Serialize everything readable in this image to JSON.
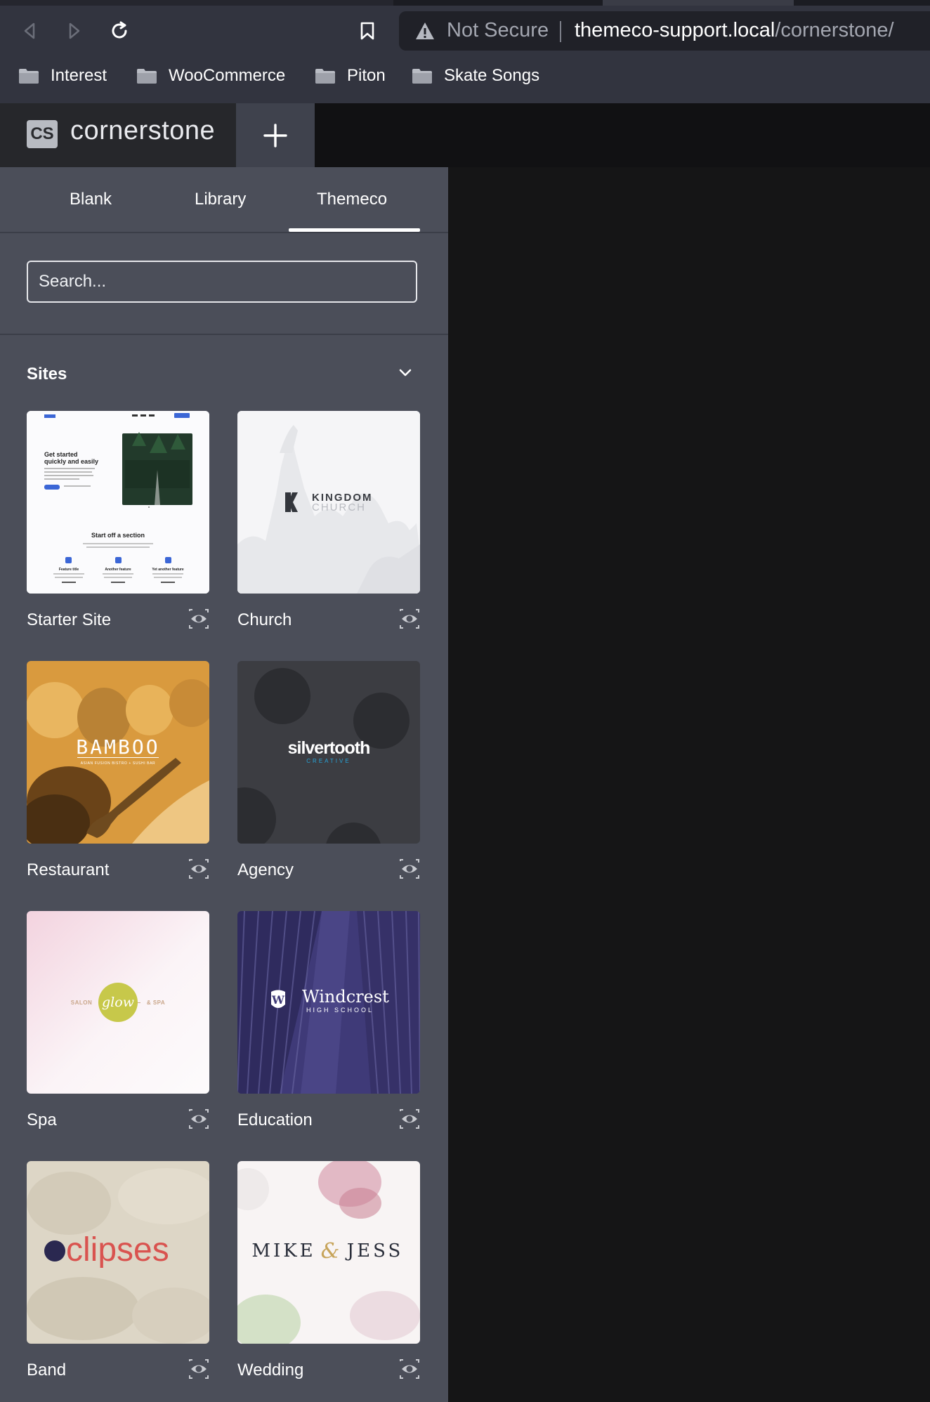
{
  "browser": {
    "security_label": "Not Secure",
    "url_host": "themeco-support.local",
    "url_path": "/cornerstone/",
    "bookmarks": [
      "Interest",
      "WooCommerce",
      "Piton",
      "Skate Songs"
    ]
  },
  "app": {
    "logo_text": "CS",
    "brand_name": "cornerstone"
  },
  "tabs": [
    "Blank",
    "Library",
    "Themeco"
  ],
  "active_tab": "Themeco",
  "search": {
    "placeholder": "Search..."
  },
  "section": {
    "title": "Sites"
  },
  "sites": [
    {
      "label": "Starter Site"
    },
    {
      "label": "Church"
    },
    {
      "label": "Restaurant"
    },
    {
      "label": "Agency"
    },
    {
      "label": "Spa"
    },
    {
      "label": "Education"
    },
    {
      "label": "Band"
    },
    {
      "label": "Wedding"
    }
  ],
  "thumbs": {
    "starter": {
      "headline1": "Get started",
      "headline2": "quickly and easily",
      "section_title": "Start off a section",
      "features": [
        "Feature title",
        "Another feature",
        "Yet another feature"
      ]
    },
    "church": {
      "line1": "KINGDOM",
      "line2": "CHURCH"
    },
    "restaurant": {
      "name": "BAMBOO",
      "tagline": "ASIAN FUSION BISTRO + SUSHI BAR"
    },
    "agency": {
      "name": "silvertooth",
      "sub": "CREATIVE"
    },
    "spa": {
      "left": "SALON",
      "center": "glow",
      "right": "& SPA"
    },
    "education": {
      "name": "Windcrest",
      "sub": "HIGH SCHOOL"
    },
    "band": {
      "name": "clipses"
    },
    "wedding": {
      "left": "MIKE",
      "amp": "&",
      "right": "JESS"
    }
  },
  "colors": {
    "sidebar": "#4b4e59",
    "restaurant_orange": "#e2a047",
    "education_purple": "#3f3a78",
    "band_red": "#d9534f",
    "spa_green": "#c7c84a"
  }
}
